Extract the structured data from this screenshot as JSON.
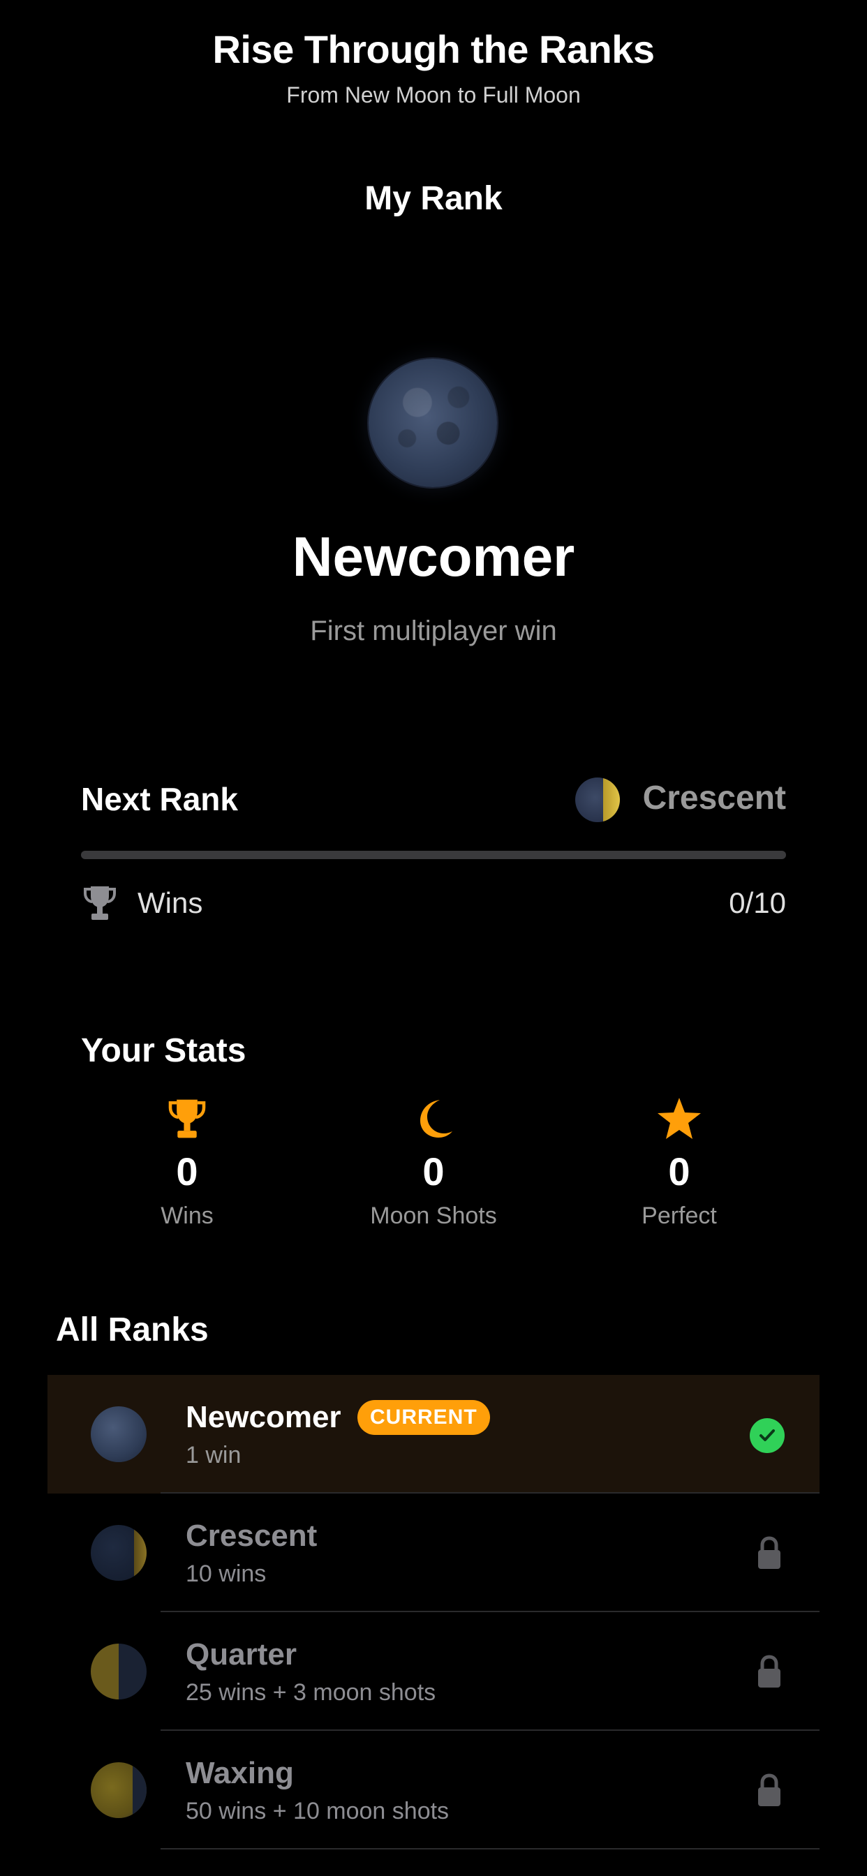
{
  "header": {
    "title": "Rise Through the Ranks",
    "subtitle": "From New Moon to Full Moon"
  },
  "section_title": "My Rank",
  "current_rank": {
    "name": "Newcomer",
    "description": "First multiplayer win",
    "icon": "new-moon-icon"
  },
  "next_rank": {
    "label": "Next Rank",
    "name": "Crescent",
    "icon": "crescent-moon-icon",
    "progress_fraction": 0,
    "requirement": {
      "icon": "trophy-icon",
      "label": "Wins",
      "value": "0/10"
    }
  },
  "stats": {
    "title": "Your Stats",
    "items": [
      {
        "icon": "trophy-icon",
        "value": "0",
        "label": "Wins"
      },
      {
        "icon": "moon-icon",
        "value": "0",
        "label": "Moon Shots"
      },
      {
        "icon": "star-icon",
        "value": "0",
        "label": "Perfect"
      }
    ]
  },
  "all_ranks": {
    "title": "All Ranks",
    "current_badge": "CURRENT",
    "items": [
      {
        "name": "Newcomer",
        "requirement": "1 win",
        "status": "current"
      },
      {
        "name": "Crescent",
        "requirement": "10 wins",
        "status": "locked"
      },
      {
        "name": "Quarter",
        "requirement": "25 wins + 3 moon shots",
        "status": "locked"
      },
      {
        "name": "Waxing",
        "requirement": "50 wins + 10 moon shots",
        "status": "locked"
      }
    ]
  },
  "colors": {
    "background": "#000000",
    "accent": "#ff9f0a",
    "success": "#30d158",
    "muted_text": "#9a9a9a",
    "current_row_bg": "#1c130a"
  }
}
